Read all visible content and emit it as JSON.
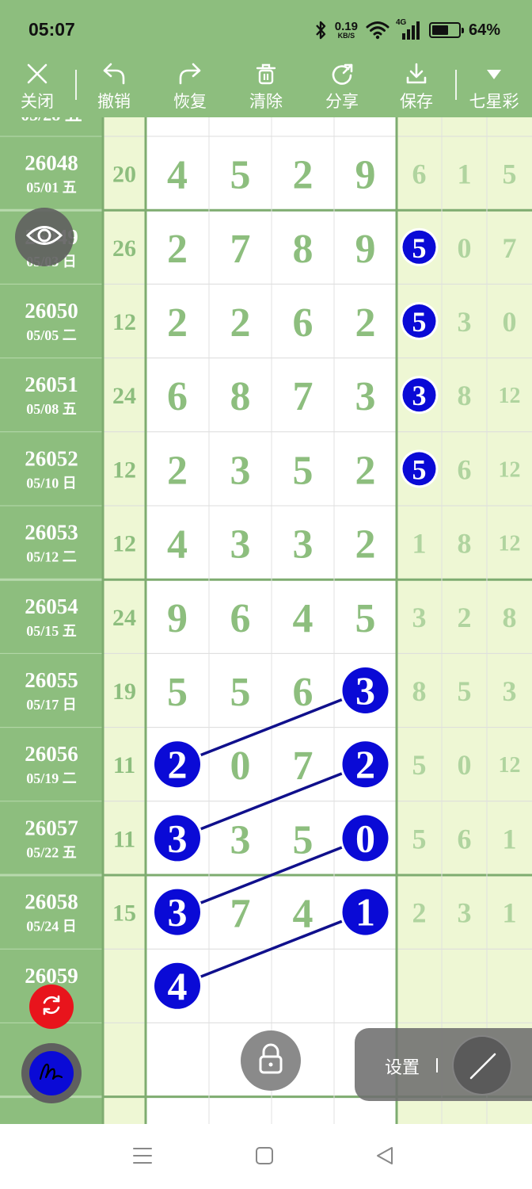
{
  "status_bar": {
    "time": "05:07",
    "net_speed_value": "0.19",
    "net_speed_unit": "KB/S",
    "signal_label": "4G",
    "battery": "64%",
    "battery_level": 0.64,
    "icons": [
      "bluetooth-icon",
      "wifi-icon",
      "cellular-signal-icon",
      "battery-icon"
    ]
  },
  "toolbar": {
    "close_label": "关闭",
    "undo_label": "撤销",
    "redo_label": "恢复",
    "clear_label": "清除",
    "share_label": "分享",
    "save_label": "保存",
    "lottery_label": "七星彩"
  },
  "colors": {
    "header_green": "#8dbe7e",
    "issue_col_green": "#8dbe7e",
    "light_green": "#eef7d4",
    "digit_green": "#8dbe7e",
    "ball_blue": "#0a0ad6",
    "line_navy": "#10108c",
    "refresh_red": "#e8141c"
  },
  "draws": [
    {
      "issue": "26048",
      "date": "05/01 五",
      "sum": "20",
      "main": [
        "4",
        "5",
        "2",
        "9"
      ],
      "tail": [
        "6",
        "1",
        "5"
      ]
    },
    {
      "issue": "26049",
      "date": "05/03 日",
      "sum": "26",
      "main": [
        "2",
        "7",
        "8",
        "9"
      ],
      "tail": [
        "5",
        "0",
        "7"
      ]
    },
    {
      "issue": "26050",
      "date": "05/05 二",
      "sum": "12",
      "main": [
        "2",
        "2",
        "6",
        "2"
      ],
      "tail": [
        "5",
        "3",
        "0"
      ]
    },
    {
      "issue": "26051",
      "date": "05/08 五",
      "sum": "24",
      "main": [
        "6",
        "8",
        "7",
        "3"
      ],
      "tail": [
        "3",
        "8",
        "12"
      ]
    },
    {
      "issue": "26052",
      "date": "05/10 日",
      "sum": "12",
      "main": [
        "2",
        "3",
        "5",
        "2"
      ],
      "tail": [
        "5",
        "6",
        "12"
      ]
    },
    {
      "issue": "26053",
      "date": "05/12 二",
      "sum": "12",
      "main": [
        "4",
        "3",
        "3",
        "2"
      ],
      "tail": [
        "1",
        "8",
        "12"
      ]
    },
    {
      "issue": "26054",
      "date": "05/15 五",
      "sum": "24",
      "main": [
        "9",
        "6",
        "4",
        "5"
      ],
      "tail": [
        "3",
        "2",
        "8"
      ]
    },
    {
      "issue": "26055",
      "date": "05/17 日",
      "sum": "19",
      "main": [
        "5",
        "5",
        "6",
        "3"
      ],
      "tail": [
        "8",
        "5",
        "3"
      ]
    },
    {
      "issue": "26056",
      "date": "05/19 二",
      "sum": "11",
      "main": [
        "2",
        "0",
        "7",
        "2"
      ],
      "tail": [
        "5",
        "0",
        "12"
      ]
    },
    {
      "issue": "26057",
      "date": "05/22 五",
      "sum": "11",
      "main": [
        "3",
        "3",
        "5",
        "0"
      ],
      "tail": [
        "5",
        "6",
        "1"
      ]
    },
    {
      "issue": "26058",
      "date": "05/24 日",
      "sum": "15",
      "main": [
        "3",
        "7",
        "4",
        "1"
      ],
      "tail": [
        "2",
        "3",
        "1"
      ]
    },
    {
      "issue": "26059",
      "date": "",
      "sum": "",
      "main": [
        "4",
        "",
        "",
        ""
      ],
      "tail": [
        "",
        "",
        ""
      ]
    }
  ],
  "marks": [
    {
      "row": 1,
      "col": "tail0"
    },
    {
      "row": 2,
      "col": "tail0"
    },
    {
      "row": 3,
      "col": "tail0"
    },
    {
      "row": 4,
      "col": "tail0"
    },
    {
      "row": 7,
      "col": "main3"
    },
    {
      "row": 8,
      "col": "main0"
    },
    {
      "row": 8,
      "col": "main3"
    },
    {
      "row": 9,
      "col": "main0"
    },
    {
      "row": 9,
      "col": "main3"
    },
    {
      "row": 10,
      "col": "main0"
    },
    {
      "row": 10,
      "col": "main3"
    },
    {
      "row": 11,
      "col": "main0"
    }
  ],
  "lines": [
    {
      "from": {
        "row": 7,
        "col": "main3"
      },
      "to": {
        "row": 8,
        "col": "main0"
      }
    },
    {
      "from": {
        "row": 8,
        "col": "main3"
      },
      "to": {
        "row": 9,
        "col": "main0"
      }
    },
    {
      "from": {
        "row": 9,
        "col": "main3"
      },
      "to": {
        "row": 10,
        "col": "main0"
      }
    },
    {
      "from": {
        "row": 10,
        "col": "main3"
      },
      "to": {
        "row": 11,
        "col": "main0"
      }
    }
  ],
  "settings": {
    "label": "设置"
  },
  "floating_icons": [
    "eye-icon",
    "refresh-icon",
    "signature-pen-icon",
    "lock-icon",
    "line-draw-icon"
  ],
  "navbar_icons": [
    "menu-icon",
    "home-icon",
    "back-icon"
  ]
}
